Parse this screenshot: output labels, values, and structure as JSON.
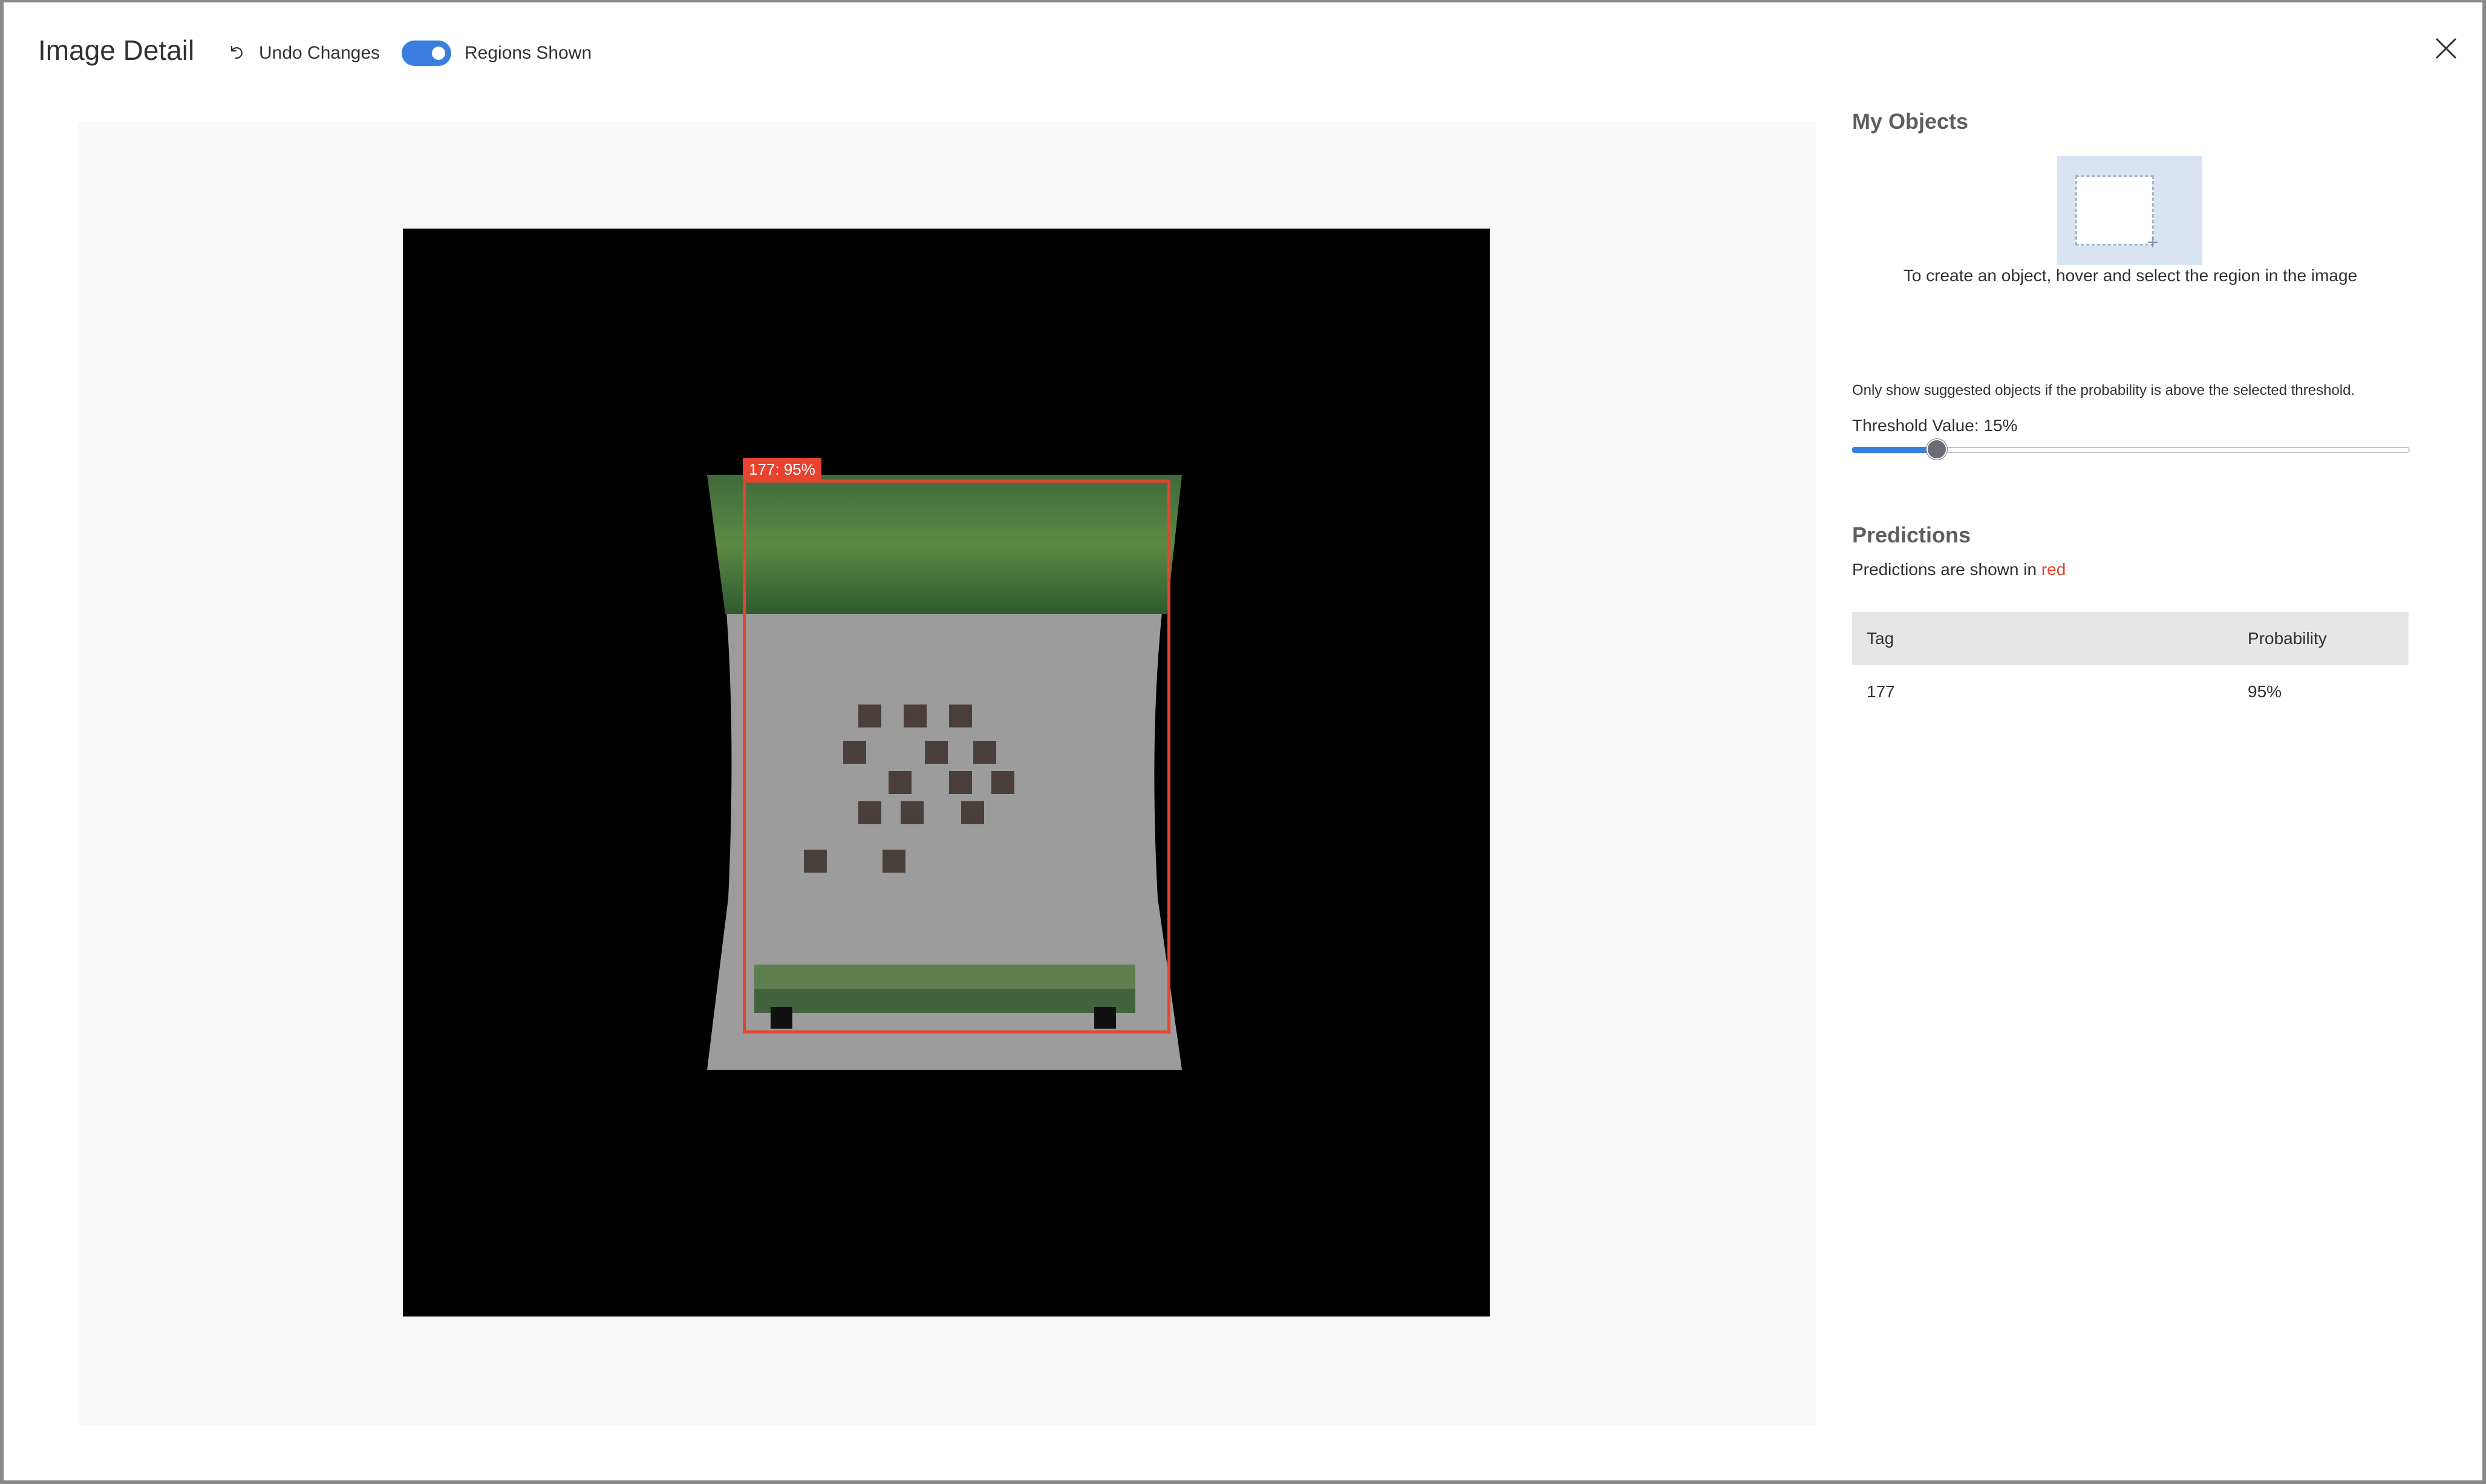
{
  "header": {
    "title": "Image Detail",
    "undo_label": "Undo Changes",
    "regions_label": "Regions Shown",
    "regions_shown": true
  },
  "image": {
    "region_label": "177: 95%",
    "region_color": "#e8432e"
  },
  "panel": {
    "objects_title": "My Objects",
    "create_hint": "To create an object, hover and select the region in the image",
    "threshold_note": "Only show suggested objects if the probability is above the selected threshold.",
    "threshold_label": "Threshold Value: 15%",
    "threshold_value": 0.15,
    "predictions_title": "Predictions",
    "predictions_sub_prefix": "Predictions are shown in ",
    "predictions_sub_color_word": "red",
    "table": {
      "headers": [
        "Tag",
        "Probability"
      ],
      "rows": [
        {
          "tag": "177",
          "probability": "95%"
        }
      ]
    }
  },
  "colors": {
    "accent": "#3a7fe0",
    "prediction": "#e8432e"
  },
  "icons": [
    "undo-icon",
    "close-icon",
    "region-create-icon"
  ]
}
